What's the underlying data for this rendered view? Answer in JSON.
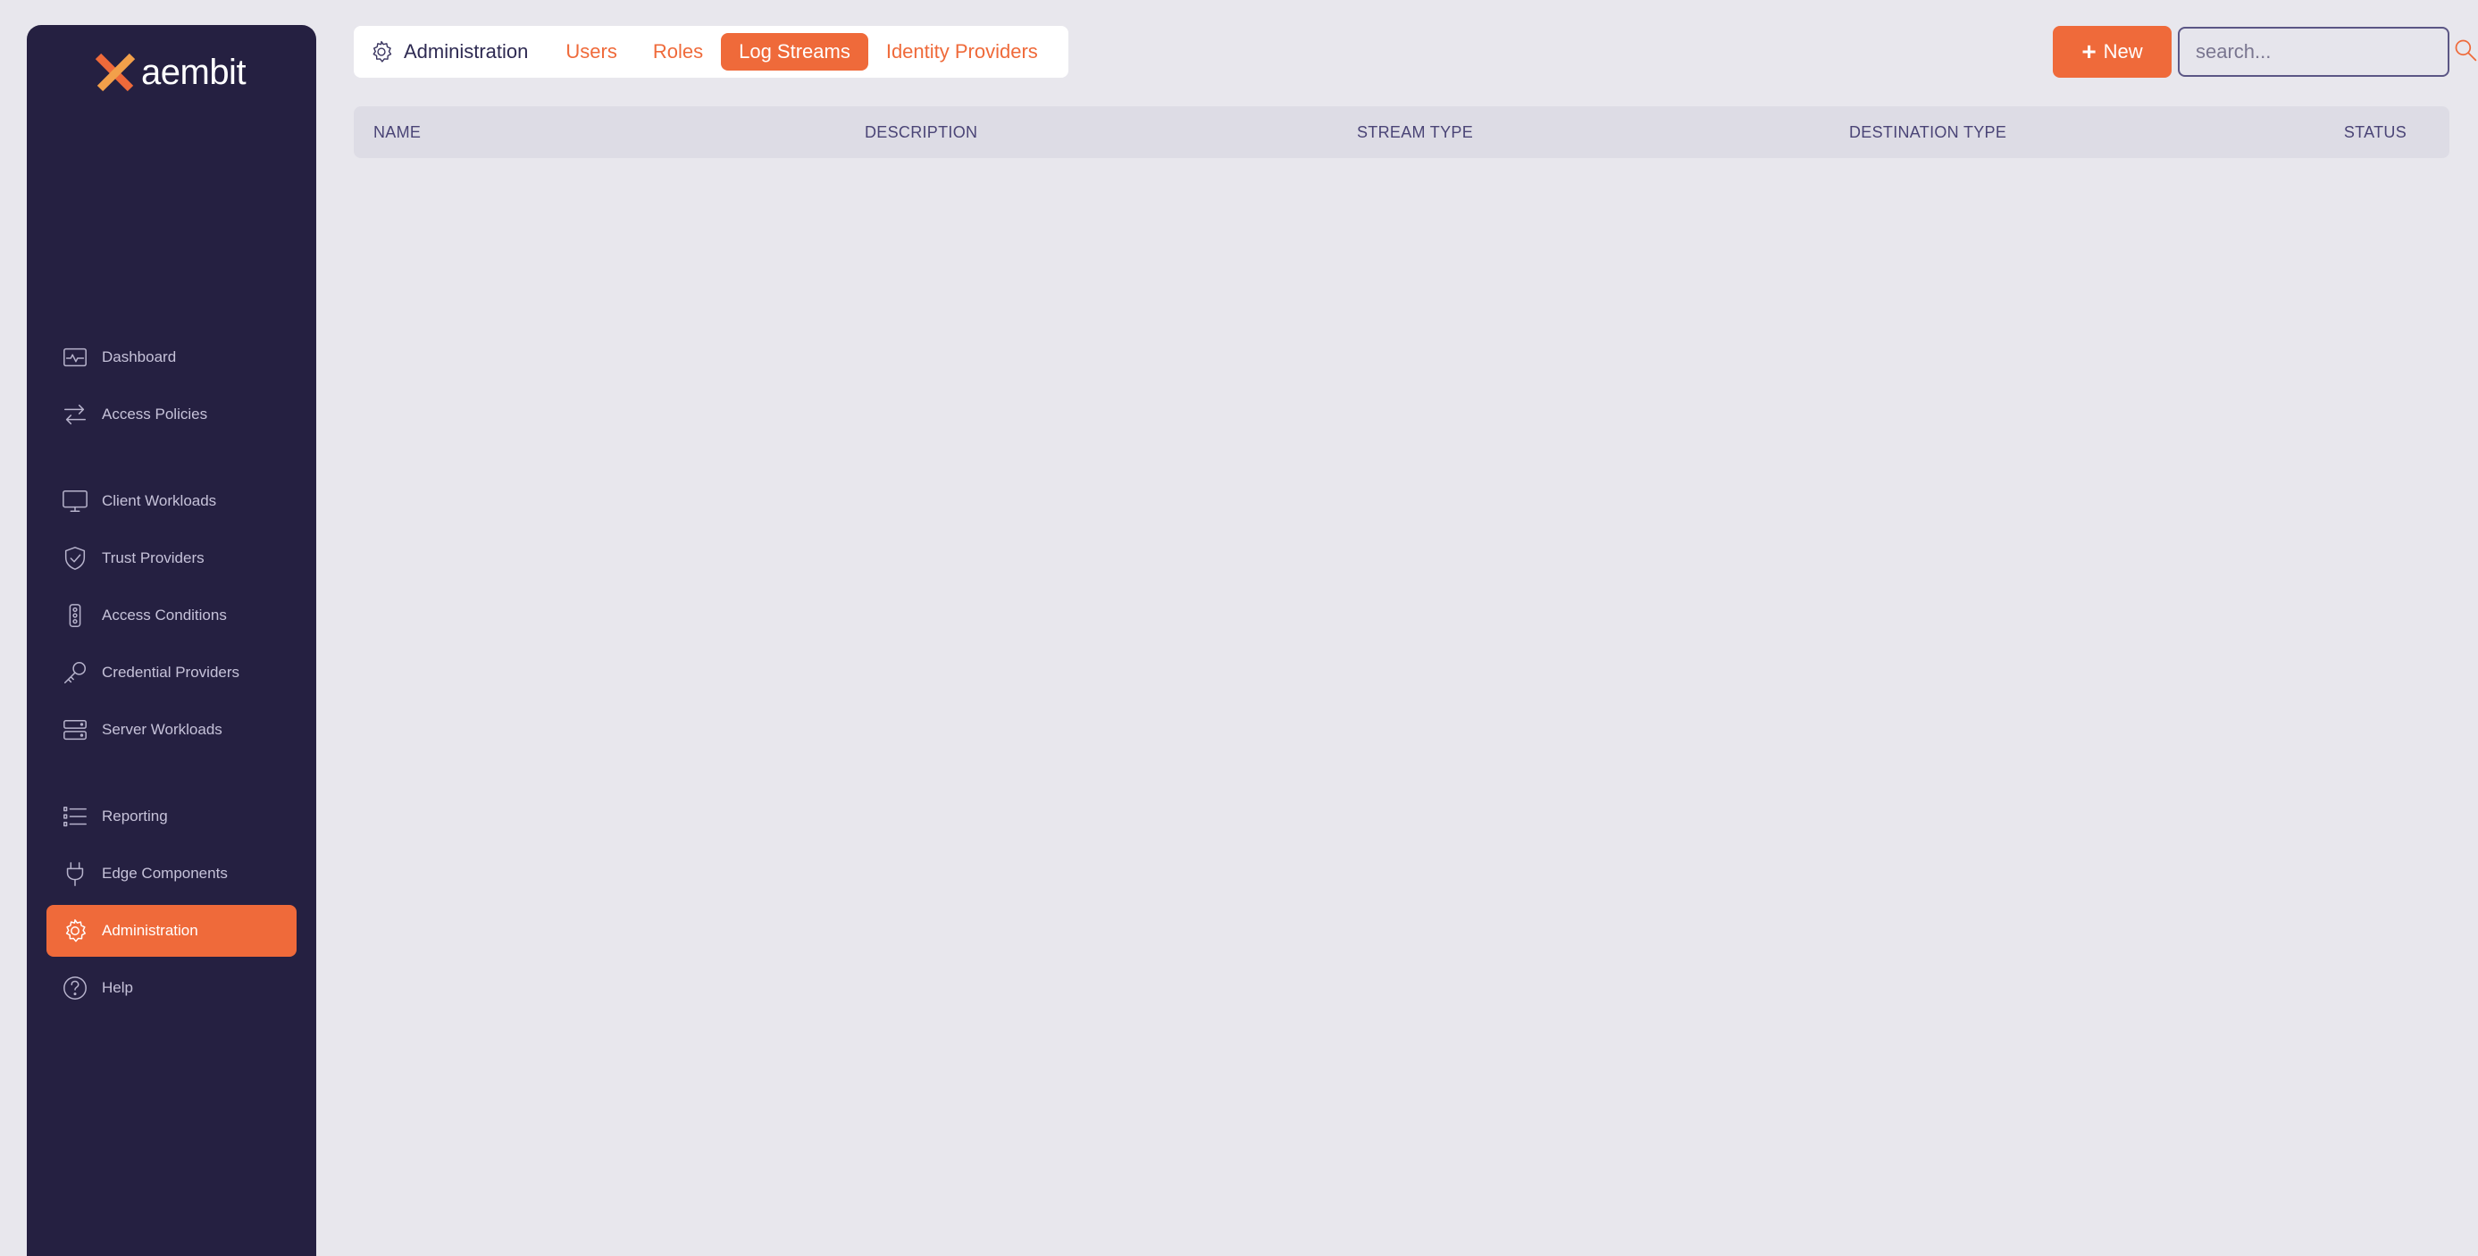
{
  "brand": {
    "name": "aembit",
    "accent": "#ef6a3a",
    "sidebar_bg": "#252041"
  },
  "sidebar": {
    "items": [
      {
        "label": "Dashboard",
        "icon": "activity-monitor-icon"
      },
      {
        "label": "Access Policies",
        "icon": "arrows-exchange-icon"
      },
      {
        "label": "Client Workloads",
        "icon": "monitor-icon"
      },
      {
        "label": "Trust Providers",
        "icon": "shield-check-icon"
      },
      {
        "label": "Access Conditions",
        "icon": "traffic-light-icon"
      },
      {
        "label": "Credential Providers",
        "icon": "key-icon"
      },
      {
        "label": "Server Workloads",
        "icon": "server-icon"
      },
      {
        "label": "Reporting",
        "icon": "list-icon"
      },
      {
        "label": "Edge Components",
        "icon": "plug-icon"
      },
      {
        "label": "Administration",
        "icon": "gear-icon",
        "active": true
      },
      {
        "label": "Help",
        "icon": "help-circle-icon"
      }
    ]
  },
  "header": {
    "section_title": "Administration",
    "tabs": [
      {
        "label": "Users"
      },
      {
        "label": "Roles"
      },
      {
        "label": "Log Streams",
        "active": true
      },
      {
        "label": "Identity Providers"
      }
    ],
    "new_button_label": "New",
    "search_placeholder": "search..."
  },
  "table": {
    "columns": [
      "NAME",
      "DESCRIPTION",
      "STREAM TYPE",
      "DESTINATION TYPE",
      "STATUS"
    ],
    "rows": []
  }
}
